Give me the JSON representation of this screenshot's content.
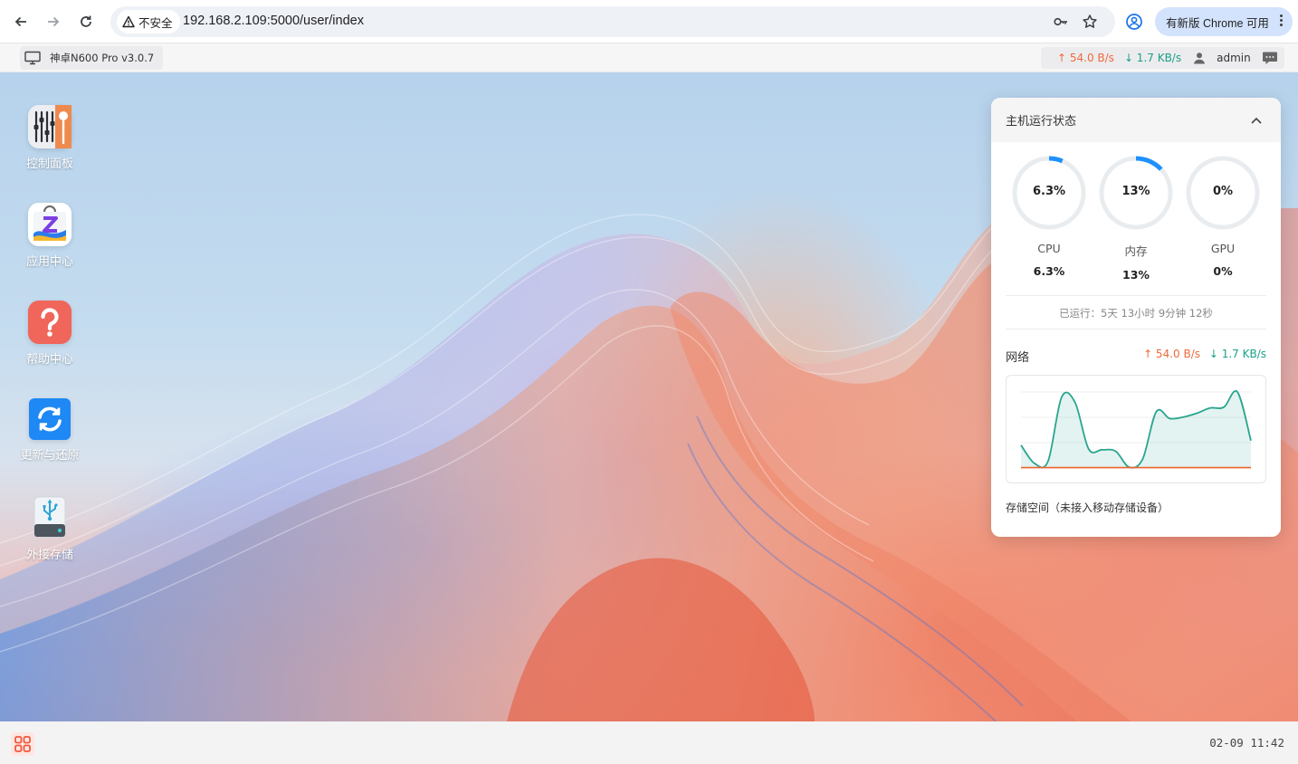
{
  "browser": {
    "security_label": "不安全",
    "url": "192.168.2.109:5000/user/index",
    "update_label": "有新版 Chrome 可用"
  },
  "header": {
    "device_name": "神卓N600 Pro v3.0.7",
    "upload_speed": "↑ 54.0 B/s",
    "download_speed": "↓ 1.7 KB/s",
    "username": "admin"
  },
  "desktop": {
    "icons": [
      {
        "label": "控制面板",
        "icon": "control-panel-icon"
      },
      {
        "label": "应用中心",
        "icon": "app-center-icon"
      },
      {
        "label": "帮助中心",
        "icon": "help-center-icon"
      },
      {
        "label": "更新与还原",
        "icon": "update-restore-icon"
      },
      {
        "label": "外接存储",
        "icon": "external-storage-icon"
      }
    ]
  },
  "status_panel": {
    "title": "主机运行状态",
    "gauges": [
      {
        "name": "CPU",
        "value_text": "6.3%",
        "percent": 6.3
      },
      {
        "name": "内存",
        "value_text": "13%",
        "percent": 13
      },
      {
        "name": "GPU",
        "value_text": "0%",
        "percent": 0
      }
    ],
    "uptime": "已运行：5天 13小时 9分钟 12秒",
    "network_label": "网络",
    "net_up": "↑ 54.0 B/s",
    "net_down": "↓ 1.7 KB/s",
    "storage_label": "存储空间（未接入移动存储设备）"
  },
  "chart_data": {
    "type": "area",
    "series": [
      {
        "values": [
          3,
          0.6,
          0.9,
          9.3,
          8.6,
          2.5,
          2.4,
          2.2,
          0.1,
          1.2,
          7.4,
          6.5,
          6.7,
          7.2,
          7.9,
          8.0,
          10.0,
          3.6
        ]
      },
      {
        "values": [
          0.05,
          0.05,
          0.05,
          0.05,
          0.05,
          0.05,
          0.05,
          0.05,
          0.05,
          0.05,
          0.05,
          0.05,
          0.05,
          0.05,
          0.05,
          0.05,
          0.05,
          0.05
        ]
      }
    ],
    "ylim": [
      0,
      10
    ],
    "colors": [
      "#2aa58f",
      "#f0632f"
    ],
    "grid": true
  },
  "taskbar": {
    "clock": "02-09 11:42"
  },
  "colors": {
    "accent_blue": "#1e90ff",
    "gauge_track": "#e9ecef",
    "upload": "#f06a3c",
    "download": "#1aa08a"
  }
}
